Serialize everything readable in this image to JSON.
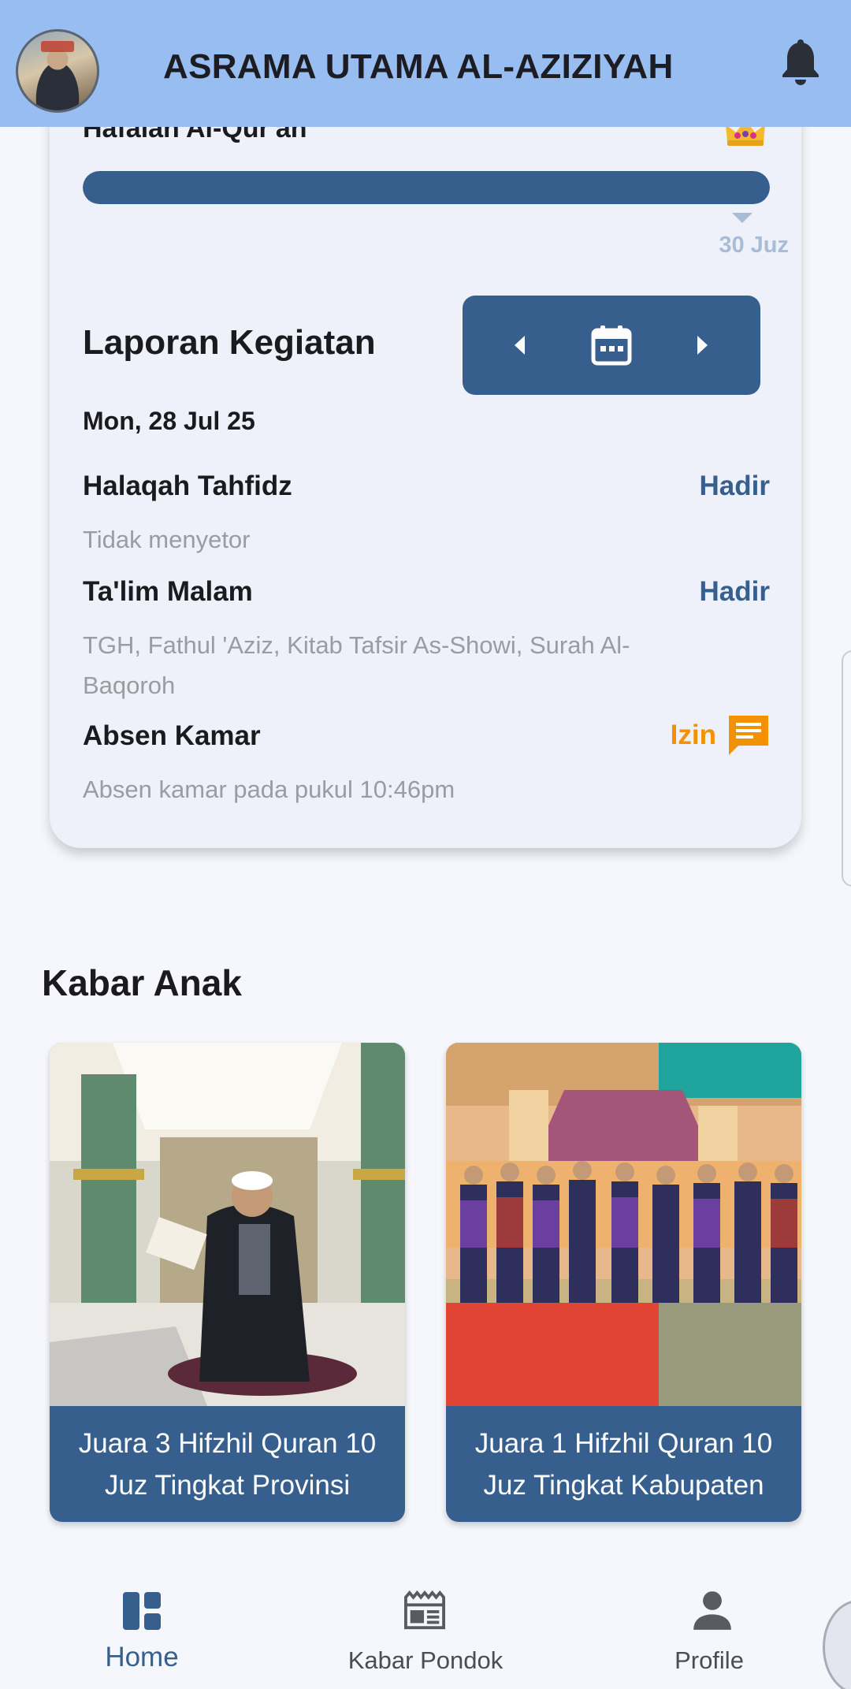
{
  "header": {
    "title": "ASRAMA UTAMA AL-AZIZIYAH",
    "avatar_icon": "profile-photo",
    "bell_icon": "bell-icon"
  },
  "hafalan": {
    "title": "Hafalan Al-Qur'an",
    "progress_fraction": 1.0,
    "progress_label": "30 Juz",
    "crown_icon": "crown-icon"
  },
  "laporan": {
    "title": "Laporan Kegiatan",
    "date": "Mon, 28 Jul 25",
    "activities": [
      {
        "name": "Halaqah Tahfidz",
        "status": "Hadir",
        "desc": "Tidak menyetor"
      },
      {
        "name": "Ta'lim Malam",
        "status": "Hadir",
        "desc": "TGH, Fathul 'Aziz, Kitab Tafsir As-Showi, Surah Al-Baqoroh"
      },
      {
        "name": "Absen Kamar",
        "status": "Izin",
        "desc": "Absen kamar pada pukul 10:46pm"
      }
    ]
  },
  "kabar_anak": {
    "title": "Kabar Anak",
    "items": [
      {
        "caption": "Juara 3 Hifzhil Quran 10 Juz Tingkat Provinsi"
      },
      {
        "caption": "Juara 1 Hifzhil Quran 10 Juz Tingkat Kabupaten"
      }
    ]
  },
  "bottom_nav": {
    "items": [
      {
        "label": "Home",
        "icon": "dashboard-icon",
        "active": true
      },
      {
        "label": "Kabar Pondok",
        "icon": "newspaper-icon",
        "active": false
      },
      {
        "label": "Profile",
        "icon": "person-icon",
        "active": false
      }
    ]
  },
  "colors": {
    "header_bg": "#98bdf0",
    "primary": "#365f8e",
    "izin": "#f39200",
    "muted_text": "#9b9ba2",
    "page_bg": "#f5f7fc"
  }
}
